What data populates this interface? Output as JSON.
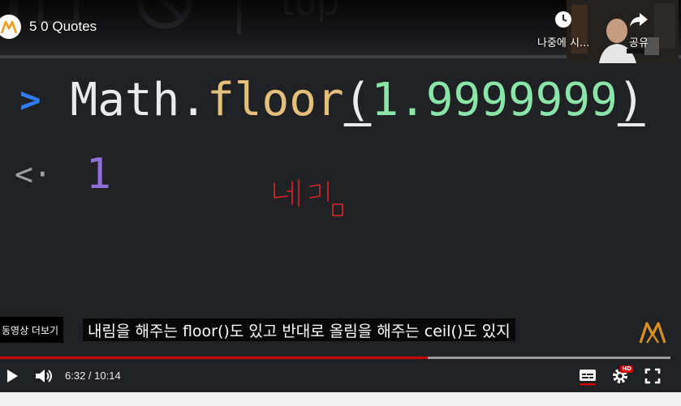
{
  "video": {
    "title": "5 0 Quotes",
    "watch_later_label": "나중에 시...",
    "share_label": "공유",
    "more_videos_label": "동영상 더보기",
    "subtitle": "내림을 해주는 floor()도 있고 반대로 올림을 해주는 ceil()도 있지"
  },
  "content": {
    "bg_text_right": "top",
    "code": {
      "object": "Math",
      "dot": ".",
      "method": "floor",
      "open_paren": "(",
      "argument": "1.9999999",
      "close_paren": ")"
    },
    "result": "1",
    "handwritten_note": "내림"
  },
  "player": {
    "current_time": "6:32",
    "duration": "10:14",
    "time_display": "6:32 / 10:14",
    "progress_fraction": 0.638,
    "buffered_fraction": 1.0,
    "hd_badge": "HD"
  },
  "colors": {
    "background": "#202124",
    "prompt": "#2f7cf6",
    "method": "#e5c07b",
    "number": "#89e6a8",
    "result": "#8e6fd6",
    "progress_played": "#cc0000",
    "handwriting": "#e0242a"
  },
  "icons": {
    "play": "play-icon",
    "volume": "volume-icon",
    "subtitles": "subtitles-icon",
    "settings": "settings-icon",
    "fullscreen": "fullscreen-icon",
    "watch_later": "clock-icon",
    "share": "share-icon"
  }
}
